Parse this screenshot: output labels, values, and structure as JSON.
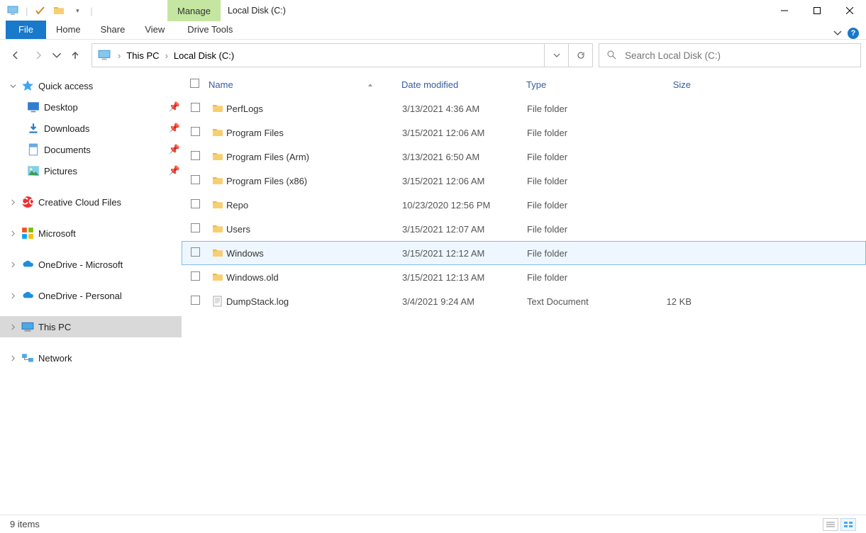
{
  "titlebar": {
    "manage_label": "Manage",
    "window_title": "Local Disk (C:)"
  },
  "ribbon": {
    "file": "File",
    "tabs": [
      "Home",
      "Share",
      "View"
    ],
    "context_tab": "Drive Tools"
  },
  "address": {
    "crumbs": [
      "This PC",
      "Local Disk (C:)"
    ]
  },
  "search": {
    "placeholder": "Search Local Disk (C:)"
  },
  "sidebar": {
    "quick_access": "Quick access",
    "quick": [
      {
        "label": "Desktop",
        "icon": "desktop"
      },
      {
        "label": "Downloads",
        "icon": "download"
      },
      {
        "label": "Documents",
        "icon": "document"
      },
      {
        "label": "Pictures",
        "icon": "pictures"
      }
    ],
    "nodes": [
      {
        "label": "Creative Cloud Files",
        "icon": "cc"
      },
      {
        "label": "Microsoft",
        "icon": "ms"
      },
      {
        "label": "OneDrive - Microsoft",
        "icon": "onedrive"
      },
      {
        "label": "OneDrive - Personal",
        "icon": "onedrive"
      },
      {
        "label": "This PC",
        "icon": "thispc",
        "selected": true
      },
      {
        "label": "Network",
        "icon": "network"
      }
    ]
  },
  "columns": {
    "name": "Name",
    "date": "Date modified",
    "type": "Type",
    "size": "Size"
  },
  "files": [
    {
      "name": "PerfLogs",
      "date": "3/13/2021 4:36 AM",
      "type": "File folder",
      "size": "",
      "icon": "folder"
    },
    {
      "name": "Program Files",
      "date": "3/15/2021 12:06 AM",
      "type": "File folder",
      "size": "",
      "icon": "folder"
    },
    {
      "name": "Program Files (Arm)",
      "date": "3/13/2021 6:50 AM",
      "type": "File folder",
      "size": "",
      "icon": "folder"
    },
    {
      "name": "Program Files (x86)",
      "date": "3/15/2021 12:06 AM",
      "type": "File folder",
      "size": "",
      "icon": "folder"
    },
    {
      "name": "Repo",
      "date": "10/23/2020 12:56 PM",
      "type": "File folder",
      "size": "",
      "icon": "folder"
    },
    {
      "name": "Users",
      "date": "3/15/2021 12:07 AM",
      "type": "File folder",
      "size": "",
      "icon": "folder"
    },
    {
      "name": "Windows",
      "date": "3/15/2021 12:12 AM",
      "type": "File folder",
      "size": "",
      "icon": "folder",
      "hovered": true
    },
    {
      "name": "Windows.old",
      "date": "3/15/2021 12:13 AM",
      "type": "File folder",
      "size": "",
      "icon": "folder"
    },
    {
      "name": "DumpStack.log",
      "date": "3/4/2021 9:24 AM",
      "type": "Text Document",
      "size": "12 KB",
      "icon": "text"
    }
  ],
  "status": {
    "item_count": "9 items"
  }
}
